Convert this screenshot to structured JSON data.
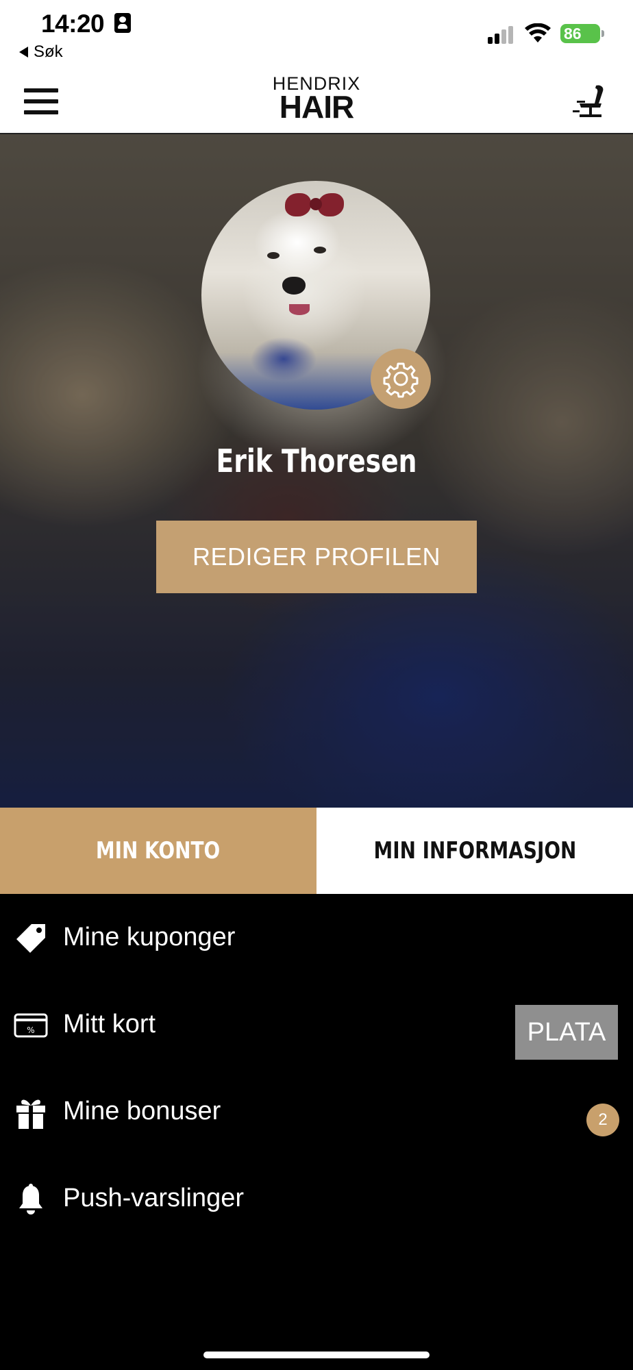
{
  "status_bar": {
    "time": "14:20",
    "back_label": "Søk",
    "battery": "86"
  },
  "header": {
    "logo_top": "HENDRIX",
    "logo_main": "HAIR"
  },
  "profile": {
    "name": "Erik Thoresen",
    "edit_button": "REDIGER PROFILEN"
  },
  "tabs": [
    {
      "label": "MIN KONTO",
      "active": true
    },
    {
      "label": "MIN INFORMASJON",
      "active": false
    }
  ],
  "menu_items": [
    {
      "label": "Mine kuponger",
      "icon": "tag-icon"
    },
    {
      "label": "Mitt kort",
      "icon": "card-icon",
      "badge": "PLATA"
    },
    {
      "label": "Mine bonuser",
      "icon": "gift-icon",
      "count": "2"
    },
    {
      "label": "Push-varslinger",
      "icon": "bell-icon"
    }
  ],
  "colors": {
    "accent": "#c8a06c",
    "background": "#000000",
    "badge_gray": "#8f8f8f",
    "battery_green": "#59c24a"
  }
}
